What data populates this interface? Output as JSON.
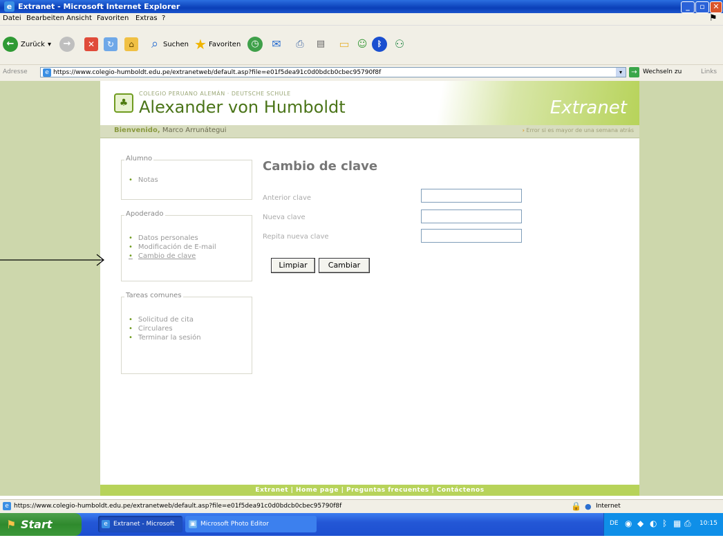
{
  "window": {
    "title": "Extranet - Microsoft Internet Explorer"
  },
  "menu": [
    "Datei",
    "Bearbeiten",
    "Ansicht",
    "Favoriten",
    "Extras",
    "?"
  ],
  "toolbar": {
    "back": "Zurück",
    "search": "Suchen",
    "favorites": "Favoriten"
  },
  "address": {
    "label": "Adresse",
    "url": "https://www.colegio-humboldt.edu.pe/extranetweb/default.asp?file=e01f5dea91c0d0bdcb0cbec95790f8f",
    "go": "Wechseln zu",
    "links": "Links"
  },
  "site": {
    "school_sub": "COLEGIO PERUANO ALEMÁN · DEUTSCHE SCHULE",
    "school_name": "Alexander von Humboldt",
    "brand": "Extranet",
    "welcome_prefix": "Bienvenido,",
    "welcome_user": "Marco Arrunátegui",
    "welcome_right": "Error si es mayor de una semana atrás"
  },
  "sidebar": {
    "alumno": {
      "title": "Alumno",
      "items": [
        "Notas"
      ]
    },
    "apoderado": {
      "title": "Apoderado",
      "items": [
        "Datos personales",
        "Modificación de E-mail",
        "Cambio de clave"
      ]
    },
    "tareas": {
      "title": "Tareas comunes",
      "items": [
        "Solicitud de cita",
        "Circulares",
        "Terminar la sesión"
      ]
    }
  },
  "form": {
    "title": "Cambio de clave",
    "labels": [
      "Anterior clave",
      "Nueva clave",
      "Repita nueva clave"
    ],
    "clear_button": "Limpiar",
    "submit_button": "Cambiar"
  },
  "footer": "Extranet | Home page | Preguntas frecuentes | Contáctenos",
  "statusbar": {
    "url": "https://www.colegio-humboldt.edu.pe/extranetweb/default.asp?file=e01f5dea91c0d0bdcb0cbec95790f8f",
    "zone": "Internet"
  },
  "taskbar": {
    "start": "Start",
    "tasks": [
      "Extranet - Microsoft I...",
      "Microsoft Photo Editor"
    ],
    "lang": "DE",
    "clock": "10:15"
  }
}
